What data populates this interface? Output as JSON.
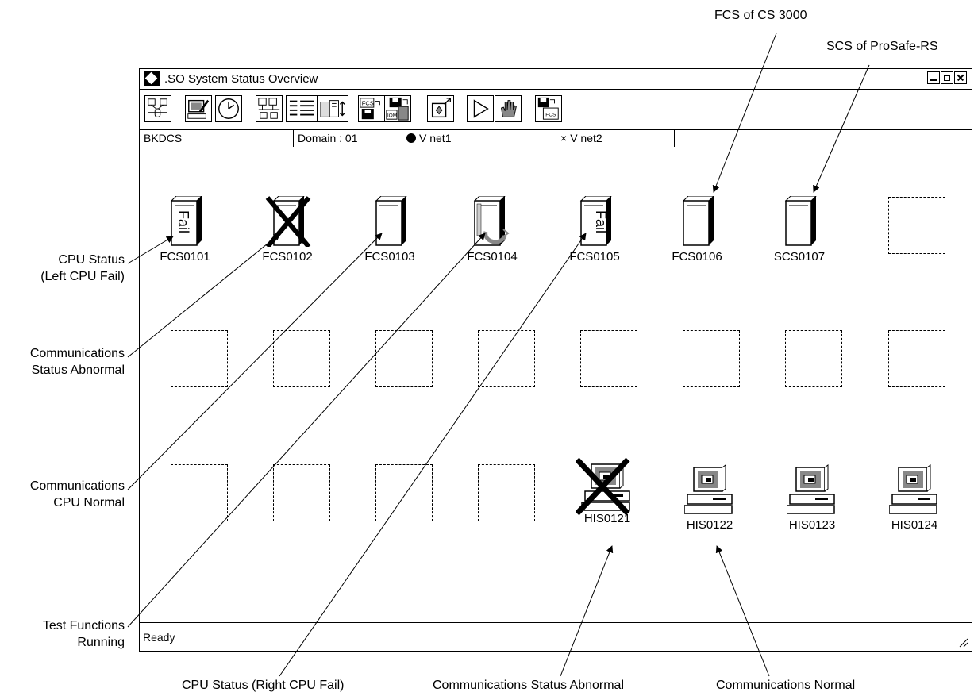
{
  "window": {
    "title": ".SO System Status Overview",
    "status_text": "Ready"
  },
  "status_bar": {
    "project": "BKDCS",
    "domain": "Domain : 01",
    "vnet1": "V net1",
    "vnet2": "V net2"
  },
  "toolbar": {
    "buttons": [
      {
        "icon": "system-view-icon"
      },
      {
        "icon": "edit-monitor-icon"
      },
      {
        "icon": "clock-icon"
      },
      {
        "icon": "hmi-network-icon"
      },
      {
        "icon": "list-icon"
      },
      {
        "icon": "cabinet-icon"
      },
      {
        "icon": "fcs-save-icon",
        "text": "FCS"
      },
      {
        "icon": "iom-save-icon",
        "text": "IOM"
      },
      {
        "icon": "export-icon"
      },
      {
        "icon": "play-icon"
      },
      {
        "icon": "hand-icon"
      },
      {
        "icon": "fcs-download-icon",
        "text": "FCS"
      }
    ]
  },
  "stations": {
    "row1": [
      {
        "name": "FCS0101",
        "type": "fcs",
        "state": "left-cpu-fail",
        "fail_text": "Fail"
      },
      {
        "name": "FCS0102",
        "type": "fcs",
        "state": "comm-abnormal"
      },
      {
        "name": "FCS0103",
        "type": "fcs",
        "state": "normal"
      },
      {
        "name": "FCS0104",
        "type": "fcs",
        "state": "test-running"
      },
      {
        "name": "FCS0105",
        "type": "fcs",
        "state": "right-cpu-fail",
        "fail_text": "Fail"
      },
      {
        "name": "FCS0106",
        "type": "fcs",
        "state": "normal"
      },
      {
        "name": "SCS0107",
        "type": "fcs",
        "state": "normal"
      }
    ],
    "row3": [
      {
        "name": "HIS0121",
        "type": "his",
        "state": "comm-abnormal"
      },
      {
        "name": "HIS0122",
        "type": "his",
        "state": "normal"
      },
      {
        "name": "HIS0123",
        "type": "his",
        "state": "normal"
      },
      {
        "name": "HIS0124",
        "type": "his",
        "state": "normal"
      }
    ]
  },
  "callouts": {
    "fcs_cs3000": "FCS of CS 3000",
    "scs_prosafe": "SCS of ProSafe-RS",
    "cpu_left_line1": "CPU Status",
    "cpu_left_line2": "(Left CPU Fail)",
    "comm_abn_line1": "Communications",
    "comm_abn_line2": "Status Abnormal",
    "comm_cpu_line1": "Communications",
    "comm_cpu_line2": "CPU Normal",
    "test_line1": "Test Functions",
    "test_line2": "Running",
    "cpu_right": "CPU Status (Right CPU Fail)",
    "comm_status_abn": "Communications Status Abnormal",
    "comm_normal": "Communications Normal"
  }
}
